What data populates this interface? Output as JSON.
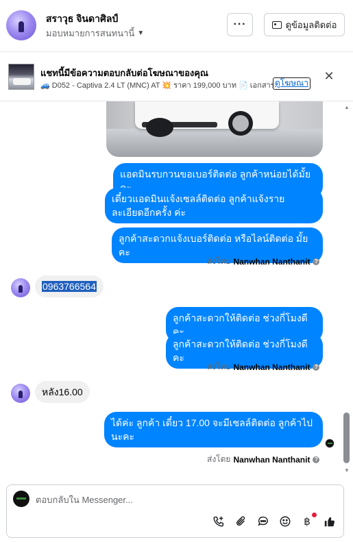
{
  "header": {
    "contact_name": "สราวุธ จินดาศิลป์",
    "assignee": "มอบหมายการสนทนานี้",
    "more_label": "···",
    "contact_info_label": "ดูข้อมูลติดต่อ"
  },
  "ad_banner": {
    "title": "แชทนี้มีข้อความตอบกลับต่อโฆษณาของคุณ",
    "detail": "🚙 D052 - Captiva 2.4 LT (MNC) AT 💥 ราคา 199,000 บาท 📄 เอกสาร...",
    "link_label": "ดูโฆษณา",
    "close_label": "✕"
  },
  "messages": {
    "out1": "แอดมินรบกวนขอเบอร์ติดต่อ ลูกค้าหน่อยได้มั้ยคะ",
    "out2": "เดี๋ยวแอดมินแจ้งเซลล์ติดต่อ ลูกค้าแจ้งรายละเอียดอีกครั้ง ค่ะ",
    "out3": "ลูกค้าสะดวกแจ้งเบอร์ติดต่อ หรือไลน์ติดต่อ มั้ยคะ",
    "sent_by_prefix": "ส่งโดย",
    "sender": "Nanwhan Nanthanit",
    "in1": "0963766564",
    "out4": "ลูกค้าสะดวกให้ติดต่อ ช่วงกี่โมงดีคะ",
    "out5": "ลูกค้าสะดวกให้ติดต่อ ช่วงกี่โมงดีคะ",
    "in2": "หลัง16.00",
    "out6": "ได้ค่ะ  ลูกค้า เดี๋ยว 17.00 จะมีเซลล์ติดต่อ ลูกค้าไปนะคะ"
  },
  "composer": {
    "placeholder": "ตอบกลับใน Messenger..."
  },
  "colors": {
    "outgoing_bubble": "#0084ff",
    "incoming_bubble": "#f0f0f0",
    "notification_dot": "#e41e3f"
  },
  "icons": [
    "phone-plus-icon",
    "paperclip-icon",
    "saved-reply-icon",
    "emoji-icon",
    "baht-payment-icon",
    "thumbs-up-icon"
  ]
}
